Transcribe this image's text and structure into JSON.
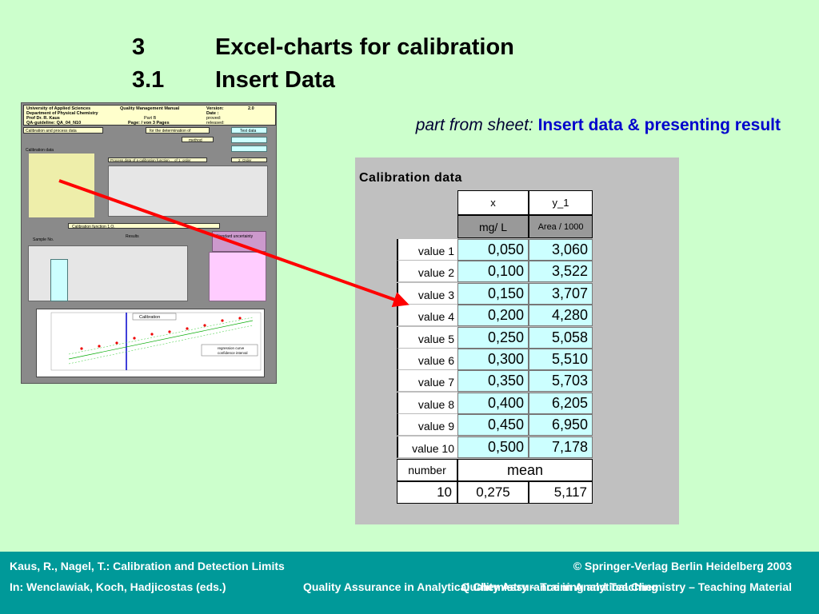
{
  "heading": {
    "line1_num": "3",
    "line1_text": "Excel-charts for calibration",
    "line2_num": "3.1",
    "line2_text": "Insert Data"
  },
  "source": {
    "prefix": "part from sheet:",
    "sheet_name": "Insert data & presenting result"
  },
  "thumbnail": {
    "org1": "University of Applied Sciences",
    "org2": "Department of Physical Chemistry",
    "org3": "Prof Dr. R. Kaus",
    "org4": "QA-guideline: QA_04_N10",
    "qm": "Quality Management Manual",
    "part": "Part B",
    "page": "Page: / von 3 Pages",
    "version_label": "Version:",
    "version_value": "2.0",
    "date_label": "Date :",
    "proved_label": "proved:",
    "released_label": "released:",
    "calib_bar": "Calibration and process data",
    "determination": "for the determination of",
    "test_data": "Test data",
    "method": "method",
    "calib_data_label": "Calibration data",
    "process_label": "Process data of a calibration function ... of 1. order",
    "second_order": "2. Order",
    "calib_function": "Calibration function 1.O.",
    "sample_label": "Sample No.",
    "standard_unc": "Standard uncertainty",
    "results_label": "Results",
    "chart_title": "Calibration",
    "legend1": "regression curve",
    "legend2": "confidence interval"
  },
  "panel": {
    "title": "Calibration data",
    "col_x": "x",
    "col_y": "y_1",
    "unit_x": "mg/ L",
    "unit_y": "Area / 1000",
    "rows": [
      {
        "label": "value 1",
        "x": "0,050",
        "y": "3,060"
      },
      {
        "label": "value 2",
        "x": "0,100",
        "y": "3,522"
      },
      {
        "label": "value 3",
        "x": "0,150",
        "y": "3,707"
      },
      {
        "label": "value 4",
        "x": "0,200",
        "y": "4,280"
      },
      {
        "label": "value 5",
        "x": "0,250",
        "y": "5,058"
      },
      {
        "label": "value 6",
        "x": "0,300",
        "y": "5,510"
      },
      {
        "label": "value 7",
        "x": "0,350",
        "y": "5,703"
      },
      {
        "label": "value 8",
        "x": "0,400",
        "y": "6,205"
      },
      {
        "label": "value 9",
        "x": "0,450",
        "y": "6,950"
      },
      {
        "label": "value 10",
        "x": "0,500",
        "y": "7,178"
      }
    ],
    "number_label": "number",
    "mean_label": "mean",
    "number_value": "10",
    "mean_x": "0,275",
    "mean_y": "5,117"
  },
  "colors": {
    "background": "#ccffcc",
    "footer": "#009999",
    "arrow": "#ff0000",
    "cell_fill": "#ccffff",
    "sheet_link": "#0000cc"
  },
  "footer": {
    "left1": "Kaus, R., Nagel, T.: Calibration and Detection Limits",
    "right1": "© Springer-Verlag Berlin Heidelberg 2003",
    "left2": "In:  Wenclawiak, Koch, Hadjicostas (eds.)",
    "middle2": "Quality Assurance in Analytical Chemistry – Training and Teaching",
    "overlay2": "Quality Assurance in Analytical Chemistry – Teaching Material"
  }
}
